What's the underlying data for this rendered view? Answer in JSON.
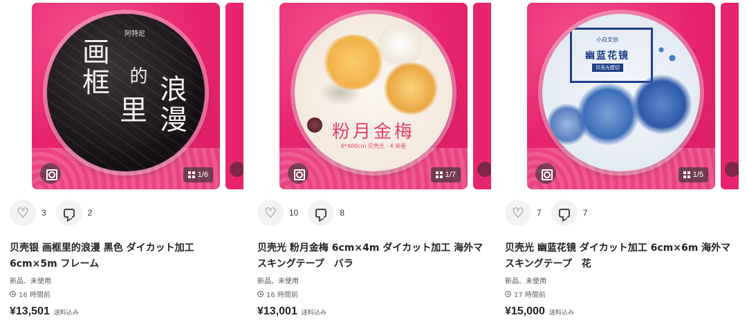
{
  "items": [
    {
      "likes": "3",
      "comments": "2",
      "page_indicator": "1/6",
      "title": "贝壳银 画框里的浪漫 黑色 ダイカット加工 6cm×5m フレーム",
      "condition": "新品、未使用",
      "time_ago": "16 時間前",
      "price": "¥13,501",
      "shipping": "送料込み",
      "tape_text": {
        "a": "画框",
        "b": "里",
        "c": "浪漫",
        "d": "的",
        "small": "阿特尼"
      },
      "color": "#141013"
    },
    {
      "likes": "10",
      "comments": "8",
      "page_indicator": "1/7",
      "title": "贝壳光 粉月金梅 6cm×4m ダイカット加工 海外マスキングテープ　バラ",
      "condition": "新品、未使用",
      "time_ago": "16 時間前",
      "price": "¥13,001",
      "shipping": "送料込み",
      "tape_text": {
        "main": "粉月金梅",
        "sub": "6*400cm 贝壳光 · 4 米卷"
      },
      "color": "#f3e7dc"
    },
    {
      "likes": "7",
      "comments": "7",
      "page_indicator": "1/5",
      "title": "贝壳光 幽蓝花镜 ダイカット加工 6cm×6m 海外マスキングテープ　花",
      "condition": "新品、未使用",
      "time_ago": "17 時間前",
      "price": "¥15,000",
      "shipping": "送料込み",
      "tape_text": {
        "main": "幽蓝花镜",
        "top": "小白文创",
        "tag": "贝壳光模切"
      },
      "color": "#1d3f86"
    }
  ],
  "icons": {
    "like": "heart-icon",
    "comment": "comment-icon",
    "scan": "image-search-icon",
    "gallery": "grid-icon",
    "time": "clock-icon"
  },
  "theme": {
    "pink_bg": "#e8246f",
    "text": "#222222",
    "muted": "#555555",
    "action_bg": "#f2f2f2"
  }
}
